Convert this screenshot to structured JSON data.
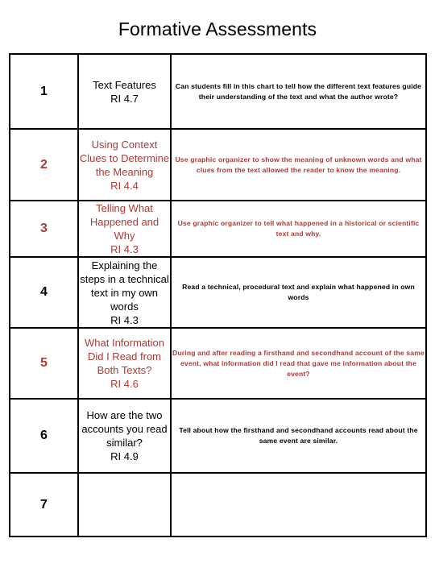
{
  "page": {
    "title": "Formative Assessments"
  },
  "table": {
    "rows": [
      {
        "number": "1",
        "topic": "Text Features\nRI 4.7",
        "description": "Can students fill in this chart to tell how the different text features guide their understanding of the text and what the author wrote?",
        "color": "#000000"
      },
      {
        "number": "2",
        "topic": "Using Context Clues to Determine the Meaning\nRI 4.4",
        "description": "Use graphic organizer to show the meaning of unknown words and what clues from the text allowed the reader to know the meaning.",
        "color": "#B03A34"
      },
      {
        "number": "3",
        "topic": "Telling What Happened and Why\nRI 4.3",
        "description": "Use graphic organizer to tell what happened in a historical or scientific text and why.",
        "color": "#B03A34"
      },
      {
        "number": "4",
        "topic": "Explaining the steps in a technical text in my own words\nRI 4.3",
        "description": "Read a technical, procedural text and explain what happened in own words",
        "color": "#000000"
      },
      {
        "number": "5",
        "topic": "What Information Did I Read from Both Texts?\nRI 4.6",
        "description": "During and after reading a firsthand and secondhand account of the same event, what information did I read that gave me information about the event?",
        "color": "#B03A34"
      },
      {
        "number": "6",
        "topic": "How are the two accounts you read similar?\nRI 4.9",
        "description": "Tell about how the firsthand and secondhand accounts read about the same event are similar.",
        "color": "#000000"
      },
      {
        "number": "7",
        "topic": "",
        "description": "",
        "color": "#000000"
      }
    ]
  }
}
